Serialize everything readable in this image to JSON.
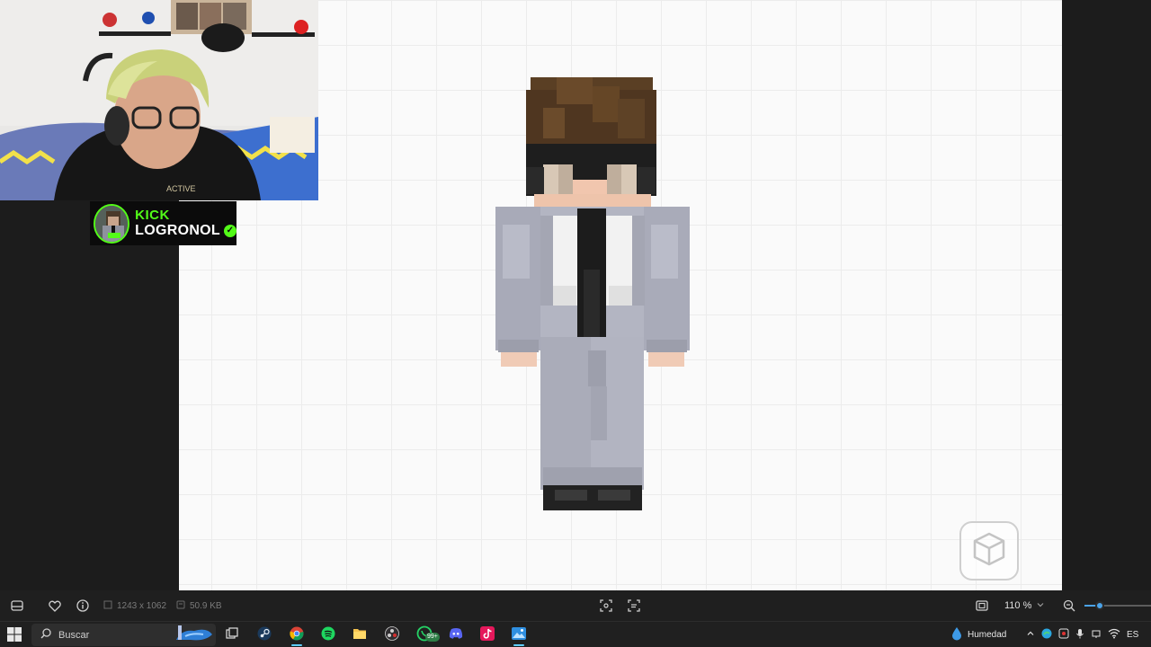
{
  "stream": {
    "brand": "KICK",
    "username": "LOGRONOL",
    "verified_icon": "check-icon"
  },
  "viewer": {
    "dimensions": "1243 x 1062",
    "file_size": "50.9 KB",
    "zoom": "110 %",
    "zoom_fraction": 0.23,
    "icons": [
      "filmstrip-icon",
      "heart-icon",
      "info-icon",
      "dimensions-icon",
      "filesize-icon",
      "face-detect-icon",
      "ocr-icon",
      "fit-window-icon",
      "chevron-down-icon",
      "zoom-out-icon",
      "view-3d-icon"
    ]
  },
  "taskbar": {
    "search_placeholder": "Buscar",
    "weather_label": "Humedad",
    "language": "ES",
    "badge_count": "99+",
    "apps": [
      "task-view",
      "steam",
      "chrome",
      "spotify",
      "file-explorer",
      "obs",
      "whatsapp",
      "discord",
      "tiktok",
      "photos"
    ]
  },
  "colors": {
    "accent": "#4aa3e8",
    "kick_green": "#53fc18",
    "suit": "#b4b6c2",
    "hair": "#5a3e22"
  }
}
